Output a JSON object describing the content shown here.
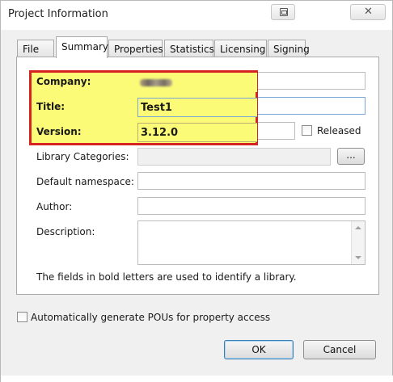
{
  "window": {
    "title": "Project Information"
  },
  "tabs": [
    {
      "label": "File"
    },
    {
      "label": "Summary",
      "active": true
    },
    {
      "label": "Properties"
    },
    {
      "label": "Statistics"
    },
    {
      "label": "Licensing"
    },
    {
      "label": "Signing"
    }
  ],
  "summary": {
    "company": {
      "label": "Company:",
      "value": ""
    },
    "title": {
      "label": "Title:",
      "value": "Test1"
    },
    "version": {
      "label": "Version:",
      "value": "3.12.0"
    },
    "released": {
      "label": "Released",
      "checked": false
    },
    "library_categories": {
      "label": "Library Categories:",
      "value": "",
      "browse_label": "..."
    },
    "default_namespace": {
      "label": "Default namespace:",
      "value": ""
    },
    "author": {
      "label": "Author:",
      "value": ""
    },
    "description": {
      "label": "Description:",
      "value": ""
    },
    "hint": "The fields in bold letters are used to identify a library."
  },
  "auto_generate": {
    "label": "Automatically generate POUs for property access",
    "checked": false
  },
  "buttons": {
    "ok": "OK",
    "cancel": "Cancel"
  },
  "colors": {
    "highlight": "#fbfb77",
    "highlight_border": "#d7231f"
  },
  "icons": {
    "restore": "restore-window-icon",
    "close": "close-icon"
  }
}
